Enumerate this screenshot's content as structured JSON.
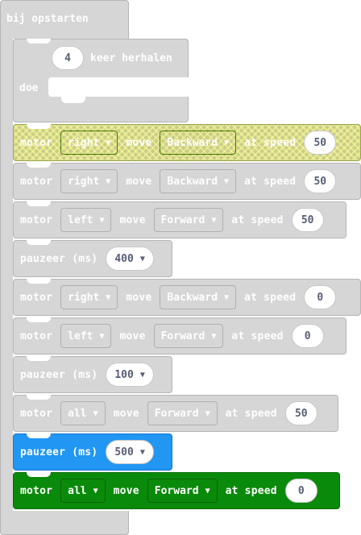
{
  "on_start": {
    "label": "bij opstarten"
  },
  "repeat": {
    "count": "4",
    "suffix_label": "keer herhalen",
    "do_label": "doe"
  },
  "labels": {
    "motor": "motor",
    "move": "move",
    "at_speed": "at speed",
    "pause": "pauzeer (ms)"
  },
  "blocks": [
    {
      "type": "motor",
      "motor": "right",
      "direction": "Backward",
      "speed": "50",
      "style": "highlight"
    },
    {
      "type": "motor",
      "motor": "right",
      "direction": "Backward",
      "speed": "50",
      "style": "disabled"
    },
    {
      "type": "motor",
      "motor": "left",
      "direction": "Forward",
      "speed": "50",
      "style": "disabled"
    },
    {
      "type": "pause",
      "ms": "400",
      "style": "disabled"
    },
    {
      "type": "motor",
      "motor": "right",
      "direction": "Backward",
      "speed": "0",
      "style": "disabled"
    },
    {
      "type": "motor",
      "motor": "left",
      "direction": "Forward",
      "speed": "0",
      "style": "disabled"
    },
    {
      "type": "pause",
      "ms": "100",
      "style": "disabled"
    },
    {
      "type": "motor",
      "motor": "all",
      "direction": "Forward",
      "speed": "50",
      "style": "disabled"
    },
    {
      "type": "pause",
      "ms": "500",
      "style": "blue"
    },
    {
      "type": "motor",
      "motor": "all",
      "direction": "Forward",
      "speed": "0",
      "style": "green"
    }
  ],
  "colors": {
    "disabled": "#d6d6d6",
    "highlight": "#c9cc8a",
    "pause_active": "#2196f3",
    "motor_active": "#0a8a0a"
  }
}
